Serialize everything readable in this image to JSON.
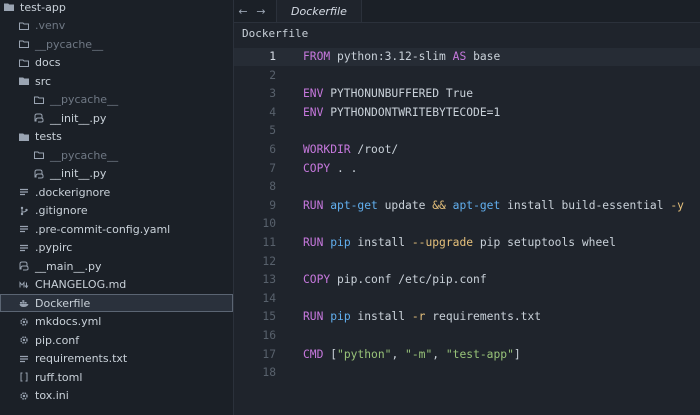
{
  "sidebar": {
    "items": [
      {
        "label": "test-app",
        "icon": "folder-open-icon",
        "depth": 0,
        "dim": false,
        "selected": false
      },
      {
        "label": ".venv",
        "icon": "folder-icon",
        "depth": 1,
        "dim": true,
        "selected": false
      },
      {
        "label": "__pycache__",
        "icon": "folder-icon",
        "depth": 1,
        "dim": true,
        "selected": false
      },
      {
        "label": "docs",
        "icon": "folder-icon",
        "depth": 1,
        "dim": false,
        "selected": false
      },
      {
        "label": "src",
        "icon": "folder-open-icon",
        "depth": 1,
        "dim": false,
        "selected": false
      },
      {
        "label": "__pycache__",
        "icon": "folder-icon",
        "depth": 2,
        "dim": true,
        "selected": false
      },
      {
        "label": "__init__.py",
        "icon": "python-icon",
        "depth": 2,
        "dim": false,
        "selected": false
      },
      {
        "label": "tests",
        "icon": "folder-open-icon",
        "depth": 1,
        "dim": false,
        "selected": false
      },
      {
        "label": "__pycache__",
        "icon": "folder-icon",
        "depth": 2,
        "dim": true,
        "selected": false
      },
      {
        "label": "__init__.py",
        "icon": "python-icon",
        "depth": 2,
        "dim": false,
        "selected": false
      },
      {
        "label": ".dockerignore",
        "icon": "lines-icon",
        "depth": 1,
        "dim": false,
        "selected": false
      },
      {
        "label": ".gitignore",
        "icon": "git-icon",
        "depth": 1,
        "dim": false,
        "selected": false
      },
      {
        "label": ".pre-commit-config.yaml",
        "icon": "lines-icon",
        "depth": 1,
        "dim": false,
        "selected": false
      },
      {
        "label": ".pypirc",
        "icon": "lines-icon",
        "depth": 1,
        "dim": false,
        "selected": false
      },
      {
        "label": "__main__.py",
        "icon": "python-icon",
        "depth": 1,
        "dim": false,
        "selected": false
      },
      {
        "label": "CHANGELOG.md",
        "icon": "markdown-icon",
        "depth": 1,
        "dim": false,
        "selected": false
      },
      {
        "label": "Dockerfile",
        "icon": "docker-icon",
        "depth": 1,
        "dim": false,
        "selected": true
      },
      {
        "label": "mkdocs.yml",
        "icon": "gear-icon",
        "depth": 1,
        "dim": false,
        "selected": false
      },
      {
        "label": "pip.conf",
        "icon": "gear-icon",
        "depth": 1,
        "dim": false,
        "selected": false
      },
      {
        "label": "requirements.txt",
        "icon": "lines-icon",
        "depth": 1,
        "dim": false,
        "selected": false
      },
      {
        "label": "ruff.toml",
        "icon": "brackets-icon",
        "depth": 1,
        "dim": false,
        "selected": false
      },
      {
        "label": "tox.ini",
        "icon": "gear-icon",
        "depth": 1,
        "dim": false,
        "selected": false
      }
    ]
  },
  "tabbar": {
    "back_glyph": "←",
    "forward_glyph": "→",
    "active_tab": "Dockerfile"
  },
  "breadcrumb": "Dockerfile",
  "editor": {
    "active_line": 1,
    "lines": [
      {
        "n": "1",
        "tokens": [
          [
            "kw",
            "FROM"
          ],
          [
            "plain",
            " python:3.12-slim "
          ],
          [
            "kw",
            "AS"
          ],
          [
            "plain",
            " base"
          ]
        ]
      },
      {
        "n": "2",
        "tokens": []
      },
      {
        "n": "3",
        "tokens": [
          [
            "kw",
            "ENV"
          ],
          [
            "plain",
            " PYTHONUNBUFFERED True"
          ]
        ]
      },
      {
        "n": "4",
        "tokens": [
          [
            "kw",
            "ENV"
          ],
          [
            "plain",
            " PYTHONDONTWRITEBYTECODE=1"
          ]
        ]
      },
      {
        "n": "5",
        "tokens": []
      },
      {
        "n": "6",
        "tokens": [
          [
            "kw",
            "WORKDIR"
          ],
          [
            "plain",
            " /root/"
          ]
        ]
      },
      {
        "n": "7",
        "tokens": [
          [
            "kw",
            "COPY"
          ],
          [
            "plain",
            " . ."
          ]
        ]
      },
      {
        "n": "8",
        "tokens": []
      },
      {
        "n": "9",
        "tokens": [
          [
            "kw",
            "RUN"
          ],
          [
            "plain",
            " "
          ],
          [
            "fn",
            "apt-get"
          ],
          [
            "plain",
            " update "
          ],
          [
            "flag",
            "&&"
          ],
          [
            "plain",
            " "
          ],
          [
            "fn",
            "apt-get"
          ],
          [
            "plain",
            " install build-essential "
          ],
          [
            "flag",
            "-y"
          ]
        ]
      },
      {
        "n": "10",
        "tokens": []
      },
      {
        "n": "11",
        "tokens": [
          [
            "kw",
            "RUN"
          ],
          [
            "plain",
            " "
          ],
          [
            "fn",
            "pip"
          ],
          [
            "plain",
            " install "
          ],
          [
            "flag",
            "--upgrade"
          ],
          [
            "plain",
            " pip setuptools wheel"
          ]
        ]
      },
      {
        "n": "12",
        "tokens": []
      },
      {
        "n": "13",
        "tokens": [
          [
            "kw",
            "COPY"
          ],
          [
            "plain",
            " pip.conf /etc/pip.conf"
          ]
        ]
      },
      {
        "n": "14",
        "tokens": []
      },
      {
        "n": "15",
        "tokens": [
          [
            "kw",
            "RUN"
          ],
          [
            "plain",
            " "
          ],
          [
            "fn",
            "pip"
          ],
          [
            "plain",
            " install "
          ],
          [
            "flag",
            "-r"
          ],
          [
            "plain",
            " requirements.txt"
          ]
        ]
      },
      {
        "n": "16",
        "tokens": []
      },
      {
        "n": "17",
        "tokens": [
          [
            "kw",
            "CMD"
          ],
          [
            "plain",
            " ["
          ],
          [
            "str",
            "\"python\""
          ],
          [
            "plain",
            ", "
          ],
          [
            "str",
            "\"-m\""
          ],
          [
            "plain",
            ", "
          ],
          [
            "str",
            "\"test-app\""
          ],
          [
            "plain",
            "]"
          ]
        ]
      },
      {
        "n": "18",
        "tokens": []
      }
    ]
  }
}
